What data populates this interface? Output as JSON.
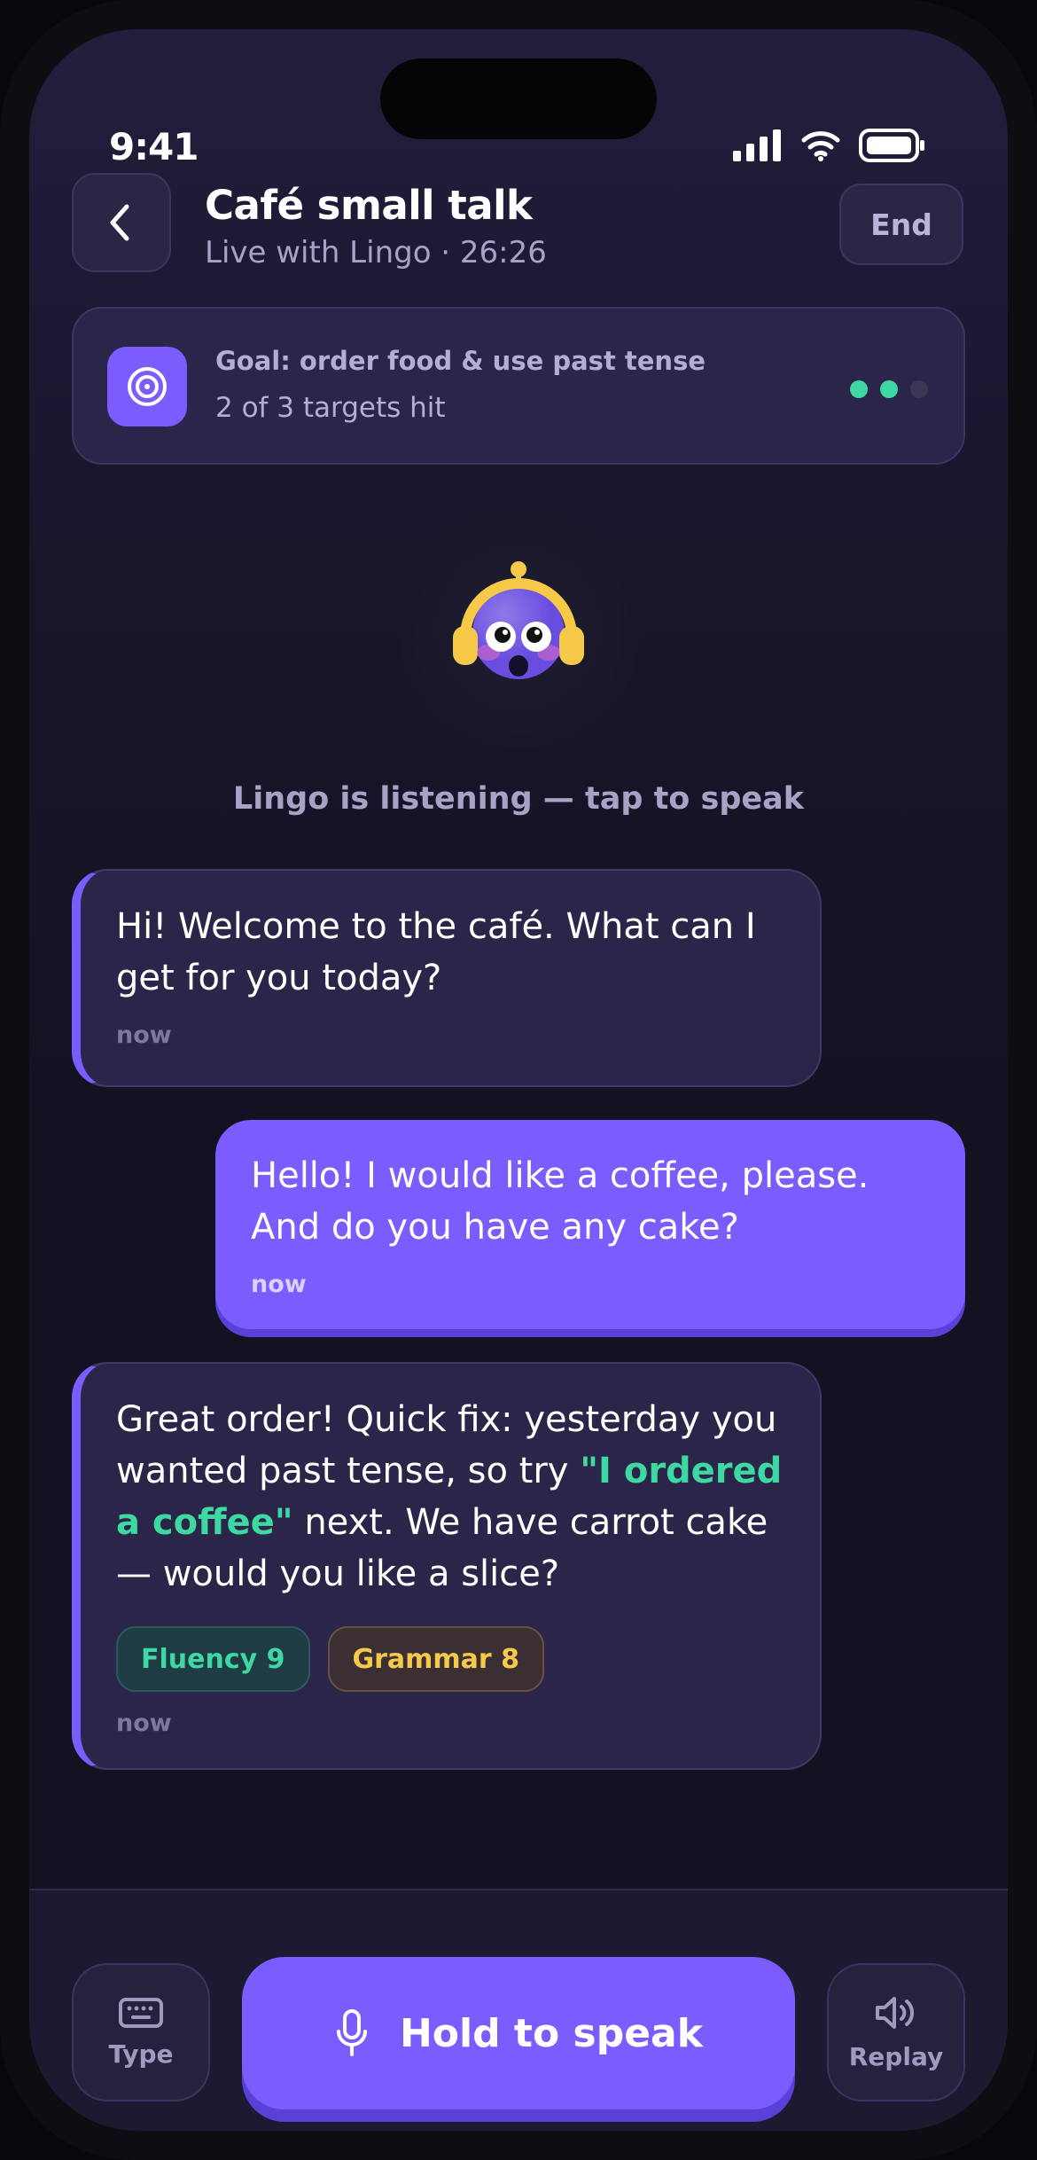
{
  "status_bar": {
    "time": "9:41"
  },
  "header": {
    "title": "Café small talk",
    "subtitle": "Live with Lingo · 26:26",
    "end_label": "End"
  },
  "goal": {
    "title": "Goal: order food & use past tense",
    "progress_text": "2 of 3 targets hit",
    "targets_hit": 2,
    "targets_total": 3
  },
  "assistant": {
    "status_text": "Lingo is listening — tap to speak"
  },
  "messages": [
    {
      "sender": "Lingo",
      "text": "Hi! Welcome to the café. What can I get for you today?",
      "time": "now"
    },
    {
      "sender": "user",
      "text": "Hello! I would like a coffee, please. And do you have any cake?",
      "time": "now"
    },
    {
      "sender": "Lingo",
      "text_before": "Great order! Quick fix: yesterday you wanted past tense, so try ",
      "highlight": "\"I ordered a coffee\"",
      "text_after": " next. We have carrot cake — would you like a slice?",
      "chips": [
        {
          "label": "Fluency 9"
        },
        {
          "label": "Grammar 8"
        }
      ],
      "time": "now"
    }
  ],
  "bottom_bar": {
    "type_label": "Type",
    "speak_label": "Hold to speak",
    "replay_label": "Replay"
  },
  "colors": {
    "accent": "#7b5cff",
    "success": "#3ed9a2",
    "warning": "#f7c948",
    "background": "#131220"
  },
  "icons": [
    "back-chevron-icon",
    "target-icon",
    "keyboard-icon",
    "microphone-icon",
    "speaker-icon",
    "signal-icon",
    "wifi-icon",
    "battery-icon"
  ]
}
